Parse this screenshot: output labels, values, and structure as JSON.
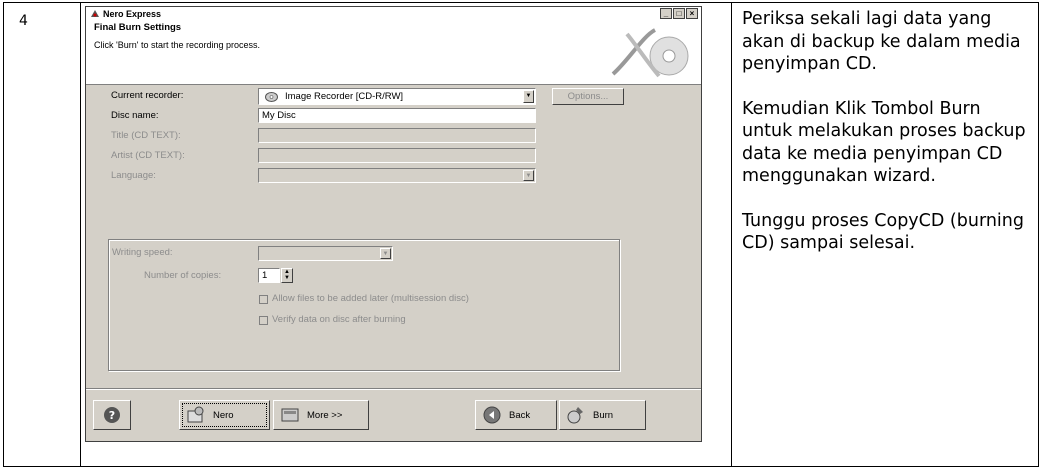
{
  "row_number": "4",
  "dialog": {
    "window_title": "Nero Express",
    "header_title": "Final Burn Settings",
    "header_subtitle": "Click 'Burn' to start the recording process.",
    "current_recorder": {
      "label": "Current recorder:",
      "value": "Image Recorder  [CD-R/RW]"
    },
    "options_button": "Options...",
    "disc_name": {
      "label": "Disc name:",
      "value": "My Disc"
    },
    "title_cd_text": {
      "label": "Title (CD TEXT):",
      "value": ""
    },
    "artist_cd_text": {
      "label": "Artist (CD TEXT):",
      "value": ""
    },
    "language": {
      "label": "Language:",
      "value": ""
    },
    "writing_speed": {
      "label": "Writing speed:",
      "value": ""
    },
    "number_of_copies": {
      "label": "Number of copies:",
      "value": "1"
    },
    "allow_files_checkbox": "Allow files to be added later (multisession disc)",
    "verify_checkbox": "Verify data on disc after burning",
    "buttons": {
      "nero": "Nero",
      "more": "More >>",
      "back": "Back",
      "burn": "Burn"
    },
    "icons": {
      "help": "help-icon",
      "nero": "nero-icon",
      "more": "more-icon",
      "back": "back-arrow-icon",
      "burn": "burn-icon",
      "recorder": "recorder-icon"
    }
  },
  "instructions": {
    "para1": "Periksa sekali lagi data yang akan di backup ke dalam media penyimpan CD.",
    "para2": "Kemudian Klik Tombol Burn untuk melakukan proses backup  data ke media penyimpan CD menggunakan wizard.",
    "para3": "Tunggu proses CopyCD (burning CD) sampai selesai."
  }
}
